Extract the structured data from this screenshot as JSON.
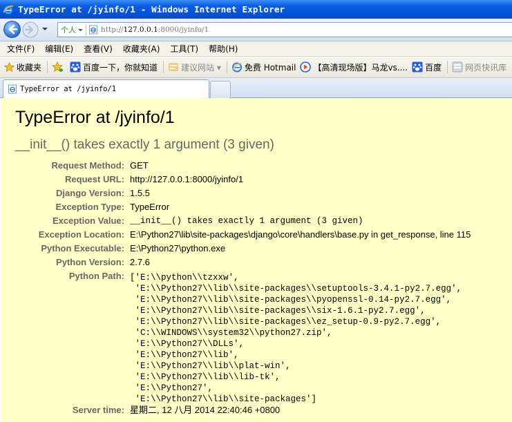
{
  "window": {
    "title": "TypeError at /jyinfo/1 - Windows Internet Explorer"
  },
  "address_bar": {
    "zone": "个人",
    "url_prefix": "http://",
    "url_host": "127.0.0.1",
    "url_rest": ":8000/jyinfo/1"
  },
  "menu": [
    "文件(F)",
    "编辑(E)",
    "查看(V)",
    "收藏夹(A)",
    "工具(T)",
    "帮助(H)"
  ],
  "favorites": {
    "label": "收藏夹",
    "items": [
      {
        "label": "百度一下，你就知道",
        "icon": "baidu-paw-icon"
      },
      {
        "label": "建议网站 ▾",
        "icon": "suggested-sites-icon"
      },
      {
        "label": "免费 Hotmail",
        "icon": "ie-page-icon"
      },
      {
        "label": "【高清现场版】马龙vs....",
        "icon": "video-play-icon"
      },
      {
        "label": "百度",
        "icon": "baidu-paw-icon"
      },
      {
        "label": "网页快讯库",
        "icon": "web-slice-icon"
      }
    ]
  },
  "tab": {
    "label": "TypeError at /jyinfo/1"
  },
  "error": {
    "title": "TypeError at /jyinfo/1",
    "summary": "__init__() takes exactly 1 argument (3 given)"
  },
  "meta": {
    "request_method": {
      "label": "Request Method:",
      "value": "GET"
    },
    "request_url": {
      "label": "Request URL:",
      "value": "http://127.0.0.1:8000/jyinfo/1"
    },
    "django_version": {
      "label": "Django Version:",
      "value": "1.5.5"
    },
    "exception_type": {
      "label": "Exception Type:",
      "value": "TypeError"
    },
    "exception_value": {
      "label": "Exception Value:",
      "value": "__init__() takes exactly 1 argument (3 given)"
    },
    "exception_location": {
      "label": "Exception Location:",
      "value": "E:\\Python27\\lib\\site-packages\\django\\core\\handlers\\base.py in get_response, line 115"
    },
    "python_executable": {
      "label": "Python Executable:",
      "value": "E:\\Python27\\python.exe"
    },
    "python_version": {
      "label": "Python Version:",
      "value": "2.7.6"
    },
    "python_path": {
      "label": "Python Path:",
      "lines": [
        "['E:\\\\python\\\\tzxxw',",
        " 'E:\\\\Python27\\\\lib\\\\site-packages\\\\setuptools-3.4.1-py2.7.egg',",
        " 'E:\\\\Python27\\\\lib\\\\site-packages\\\\pyopenssl-0.14-py2.7.egg',",
        " 'E:\\\\Python27\\\\lib\\\\site-packages\\\\six-1.6.1-py2.7.egg',",
        " 'E:\\\\Python27\\\\lib\\\\site-packages\\\\ez_setup-0.9-py2.7.egg',",
        " 'C:\\\\WINDOWS\\\\system32\\\\python27.zip',",
        " 'E:\\\\Python27\\\\DLLs',",
        " 'E:\\\\Python27\\\\lib',",
        " 'E:\\\\Python27\\\\lib\\\\plat-win',",
        " 'E:\\\\Python27\\\\lib\\\\lib-tk',",
        " 'E:\\\\Python27',",
        " 'E:\\\\Python27\\\\lib\\\\site-packages']"
      ]
    },
    "server_time": {
      "label": "Server time:",
      "value": "星期二, 12 八月 2014 22:40:46 +0800"
    }
  },
  "colors": {
    "content_bg": "#ffffc8",
    "label_gray": "#666666",
    "titlebar_blue": "#0553d6"
  }
}
